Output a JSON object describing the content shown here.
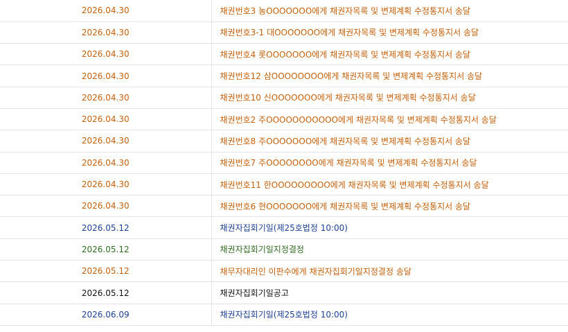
{
  "colors": {
    "orange": "#c45f0a",
    "blue": "#1c3f94",
    "green": "#2e6b20",
    "black": "#111111",
    "divider": "#e3e3e3"
  },
  "rows": [
    {
      "date": "2026.04.30",
      "content": "채권번호3 농OOOOOOO에게 채권자목록 및 변제계획 수정통지서 송달",
      "color": "orange"
    },
    {
      "date": "2026.04.30",
      "content": "채권번호3-1 대OOOOOOO에게 채권자목록 및 변제계획 수정통지서 송달",
      "color": "orange"
    },
    {
      "date": "2026.04.30",
      "content": "채권번호4 롯OOOOOOO에게 채권자목록 및 변제계획 수정통지서 송달",
      "color": "orange"
    },
    {
      "date": "2026.04.30",
      "content": "채권번호12 삼OOOOOOOO에게 채권자목록 및 변제계획 수정통지서 송달",
      "color": "orange"
    },
    {
      "date": "2026.04.30",
      "content": "채권번호10 신OOOOOOO에게 채권자목록 및 변제계획 수정통지서 송달",
      "color": "orange"
    },
    {
      "date": "2026.04.30",
      "content": "채권번호2 주OOOOOOOOOOO에게 채권자목록 및 변제계획 수정통지서 송달",
      "color": "orange"
    },
    {
      "date": "2026.04.30",
      "content": "채권번호8 주OOOOOOO에게 채권자목록 및 변제계획 수정통지서 송달",
      "color": "orange"
    },
    {
      "date": "2026.04.30",
      "content": "채권번호7 주OOOOOOOO에게 채권자목록 및 변제계획 수정통지서 송달",
      "color": "orange"
    },
    {
      "date": "2026.04.30",
      "content": "채권번호11 한OOOOOOOOO에게 채권자목록 및 변제계획 수정통지서 송달",
      "color": "orange"
    },
    {
      "date": "2026.04.30",
      "content": "채권번호6 현OOOOOOO에게 채권자목록 및 변제계획 수정통지서 송달",
      "color": "orange"
    },
    {
      "date": "2026.05.12",
      "content": "채권자집회기일(제25호법정 10:00)",
      "color": "blue"
    },
    {
      "date": "2026.05.12",
      "content": "채권자집회기일지정결정",
      "color": "green"
    },
    {
      "date": "2026.05.12",
      "content": "채무자대리인 이판수에게 채권자집회기일지정결정 송달",
      "color": "orange"
    },
    {
      "date": "2026.05.12",
      "content": "채권자집회기일공고",
      "color": "black"
    },
    {
      "date": "2026.06.09",
      "content": "채권자집회기일(제25호법정 10:00)",
      "color": "blue"
    }
  ]
}
